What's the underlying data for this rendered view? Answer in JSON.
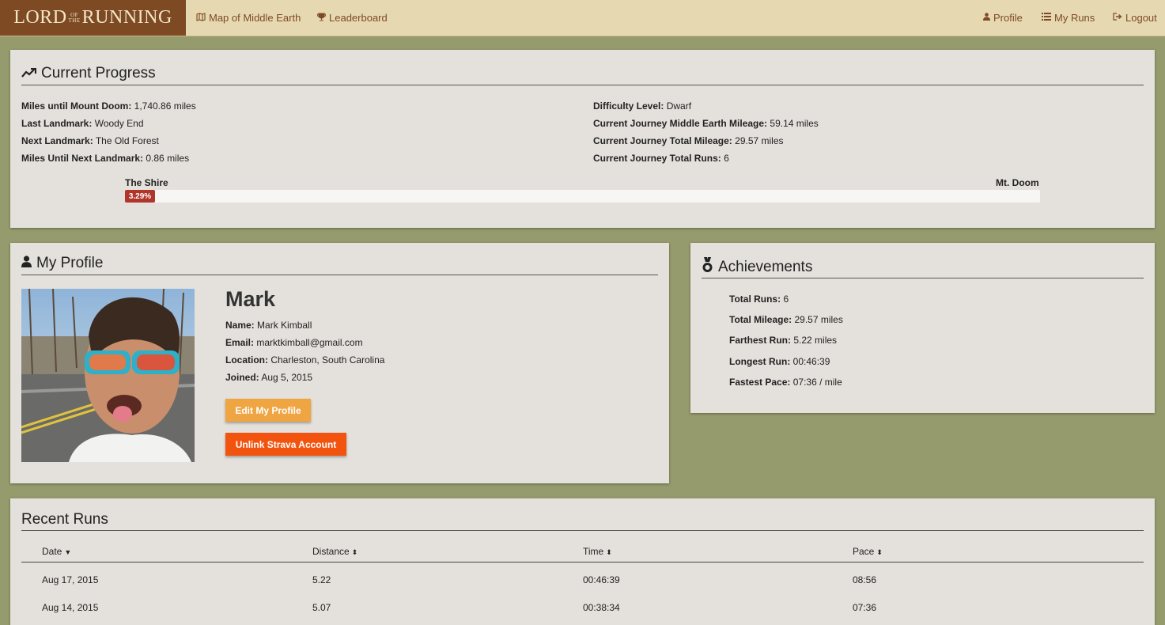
{
  "nav": {
    "brand": {
      "left": "LORD",
      "of": "OF",
      "the": "THE",
      "right": "RUNNING"
    },
    "map_label": "Map of Middle Earth",
    "leaderboard_label": "Leaderboard",
    "profile_label": "Profile",
    "myruns_label": "My Runs",
    "logout_label": "Logout"
  },
  "progress": {
    "title": "Current Progress",
    "left": [
      {
        "label": "Miles until Mount Doom:",
        "value": "1,740.86 miles"
      },
      {
        "label": "Last Landmark:",
        "value": "Woody End"
      },
      {
        "label": "Next Landmark:",
        "value": "The Old Forest"
      },
      {
        "label": "Miles Until Next Landmark:",
        "value": "0.86 miles"
      }
    ],
    "right": [
      {
        "label": "Difficulty Level:",
        "value": "Dwarf"
      },
      {
        "label": "Current Journey Middle Earth Mileage:",
        "value": "59.14 miles"
      },
      {
        "label": "Current Journey Total Mileage:",
        "value": "29.57 miles"
      },
      {
        "label": "Current Journey Total Runs:",
        "value": "6"
      }
    ],
    "start_label": "The Shire",
    "end_label": "Mt. Doom",
    "percent_text": "3.29%",
    "percent_value": 3.29,
    "bar_color": "#b0352a"
  },
  "profile": {
    "title": "My Profile",
    "display_name": "Mark",
    "fields": [
      {
        "label": "Name:",
        "value": "Mark Kimball"
      },
      {
        "label": "Email:",
        "value": "marktkimball@gmail.com"
      },
      {
        "label": "Location:",
        "value": "Charleston, South Carolina"
      },
      {
        "label": "Joined:",
        "value": "Aug 5, 2015"
      }
    ],
    "edit_button": "Edit My Profile",
    "unlink_button": "Unlink Strava Account",
    "edit_color": "#f0a543",
    "unlink_color": "#f2530e"
  },
  "achievements": {
    "title": "Achievements",
    "items": [
      {
        "label": "Total Runs:",
        "value": "6"
      },
      {
        "label": "Total Mileage:",
        "value": "29.57 miles"
      },
      {
        "label": "Farthest Run:",
        "value": "5.22 miles"
      },
      {
        "label": "Longest Run:",
        "value": "00:46:39"
      },
      {
        "label": "Fastest Pace:",
        "value": "07:36 / mile"
      }
    ]
  },
  "runs": {
    "title": "Recent Runs",
    "columns": [
      "Date",
      "Distance",
      "Time",
      "Pace"
    ],
    "rows": [
      [
        "Aug 17, 2015",
        "5.22",
        "00:46:39",
        "08:56"
      ],
      [
        "Aug 14, 2015",
        "5.07",
        "00:38:34",
        "07:36"
      ]
    ]
  },
  "icons": {
    "map": "map-icon",
    "leaderboard": "trophy-icon",
    "profile": "user-icon",
    "myruns": "list-icon",
    "logout": "sign-out-icon",
    "progress": "trend-up-icon",
    "achievements": "medal-icon",
    "sort_desc": "caret-down-icon",
    "sort": "sort-icon"
  }
}
